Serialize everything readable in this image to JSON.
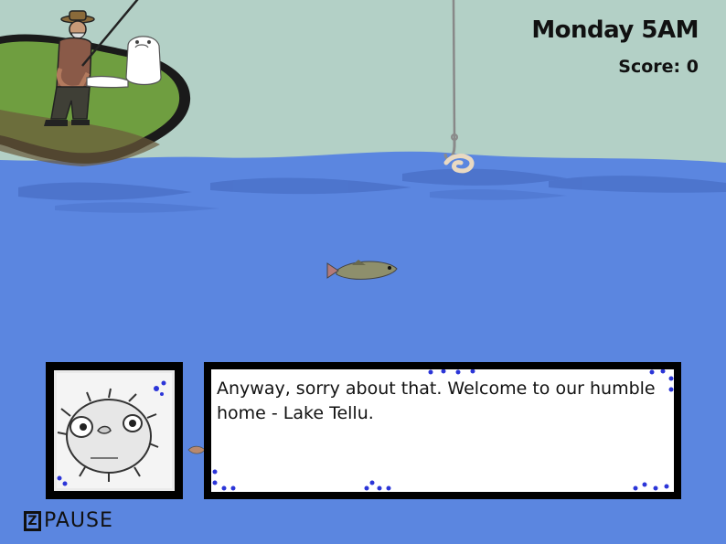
{
  "hud": {
    "day_time": "Monday 5AM",
    "score_label": "Score: 0"
  },
  "dialog": {
    "text": "Anyway, sorry about that. Welcome to our humble home - Lake Tellu."
  },
  "pause": {
    "key": "Z",
    "label": "PAUSE"
  },
  "colors": {
    "sky": "#b3d0c6",
    "water": "#5b86e0",
    "grass": "#6f9e40",
    "dots": "#2b35d8"
  },
  "icons": {
    "pause_key": "z-key-icon",
    "portrait": "pufferfish-icon"
  }
}
